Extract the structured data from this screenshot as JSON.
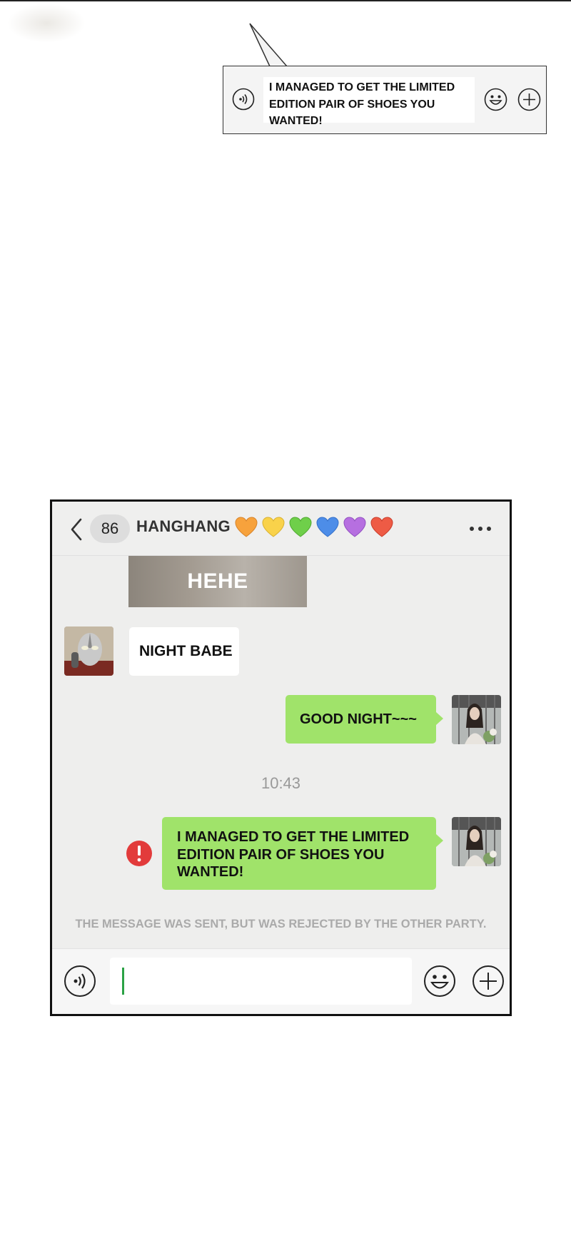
{
  "speech_panel": {
    "message": "I MANAGED TO GET THE LIMITED EDITION PAIR OF SHOES YOU WANTED!"
  },
  "chat": {
    "unread_count": "86",
    "contact_name": "HANGHANG",
    "hearts": [
      {
        "name": "orange-heart-icon",
        "color": "#f7a23c"
      },
      {
        "name": "yellow-heart-icon",
        "color": "#f9d24a"
      },
      {
        "name": "green-heart-icon",
        "color": "#6fcf4a"
      },
      {
        "name": "blue-heart-icon",
        "color": "#4d8de8"
      },
      {
        "name": "purple-heart-icon",
        "color": "#b66fe0"
      },
      {
        "name": "red-heart-icon",
        "color": "#ee5b45"
      }
    ],
    "image_caption": "HEHE",
    "messages": {
      "incoming_1": "NIGHT BABE",
      "outgoing_1": "GOOD NIGHT~~~",
      "timestamp": "10:43",
      "outgoing_2": "I MANAGED TO GET THE LIMITED EDITION PAIR OF SHOES YOU WANTED!"
    },
    "rejection_notice": "THE MESSAGE WAS SENT, BUT WAS REJECTED BY THE OTHER PARTY."
  },
  "colors": {
    "sent_bubble": "#a0e36a",
    "error": "#e23b3b",
    "cursor": "#2ba245"
  }
}
